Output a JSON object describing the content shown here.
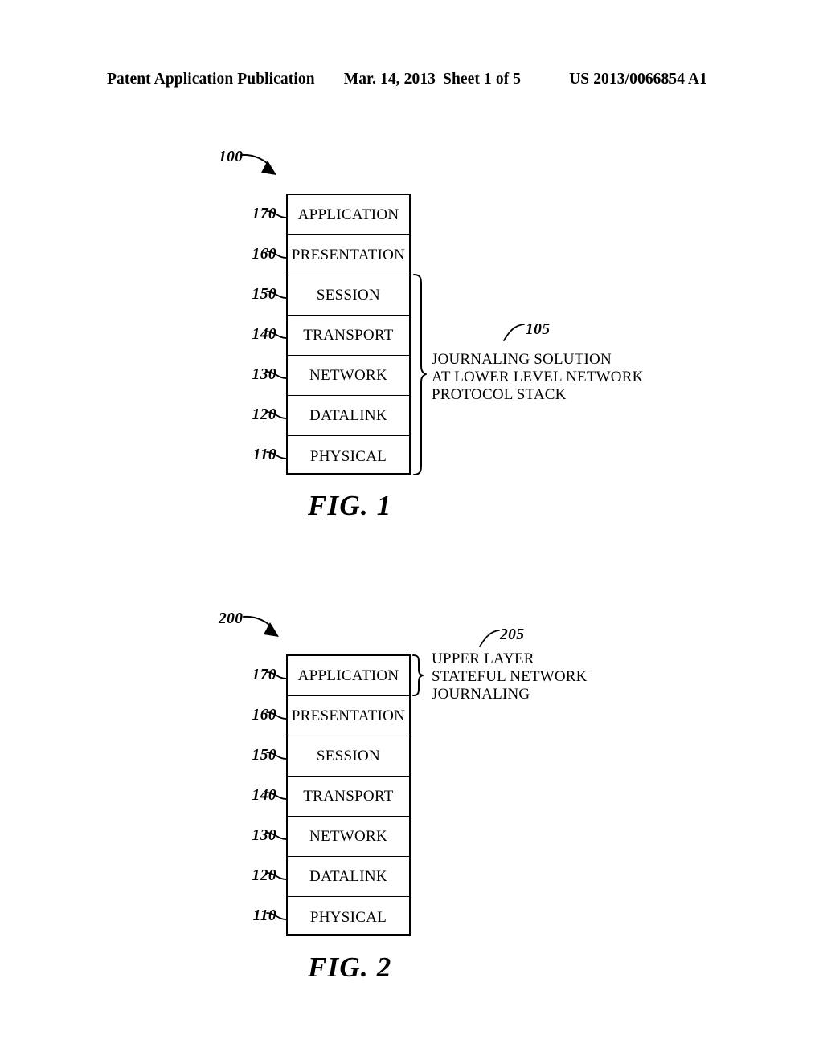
{
  "header": {
    "publication": "Patent Application Publication",
    "date": "Mar. 14, 2013",
    "sheet": "Sheet 1 of 5",
    "patent_number": "US 2013/0066854 A1"
  },
  "figures": [
    {
      "id": "fig1",
      "caption": "FIG. 1",
      "diagram_ref": "100",
      "layers": [
        {
          "ref": "170",
          "label": "APPLICATION"
        },
        {
          "ref": "160",
          "label": "PRESENTATION"
        },
        {
          "ref": "150",
          "label": "SESSION"
        },
        {
          "ref": "140",
          "label": "TRANSPORT"
        },
        {
          "ref": "130",
          "label": "NETWORK"
        },
        {
          "ref": "120",
          "label": "DATALINK"
        },
        {
          "ref": "110",
          "label": "PHYSICAL"
        }
      ],
      "annotation": {
        "ref": "105",
        "lines": [
          "JOURNALING SOLUTION",
          "AT LOWER LEVEL NETWORK",
          "PROTOCOL STACK"
        ],
        "brace_covers": [
          "SESSION",
          "TRANSPORT",
          "NETWORK",
          "DATALINK",
          "PHYSICAL"
        ]
      }
    },
    {
      "id": "fig2",
      "caption": "FIG. 2",
      "diagram_ref": "200",
      "layers": [
        {
          "ref": "170",
          "label": "APPLICATION"
        },
        {
          "ref": "160",
          "label": "PRESENTATION"
        },
        {
          "ref": "150",
          "label": "SESSION"
        },
        {
          "ref": "140",
          "label": "TRANSPORT"
        },
        {
          "ref": "130",
          "label": "NETWORK"
        },
        {
          "ref": "120",
          "label": "DATALINK"
        },
        {
          "ref": "110",
          "label": "PHYSICAL"
        }
      ],
      "annotation": {
        "ref": "205",
        "lines": [
          "UPPER LAYER",
          "STATEFUL NETWORK",
          "JOURNALING"
        ],
        "brace_covers": [
          "APPLICATION"
        ]
      }
    }
  ]
}
